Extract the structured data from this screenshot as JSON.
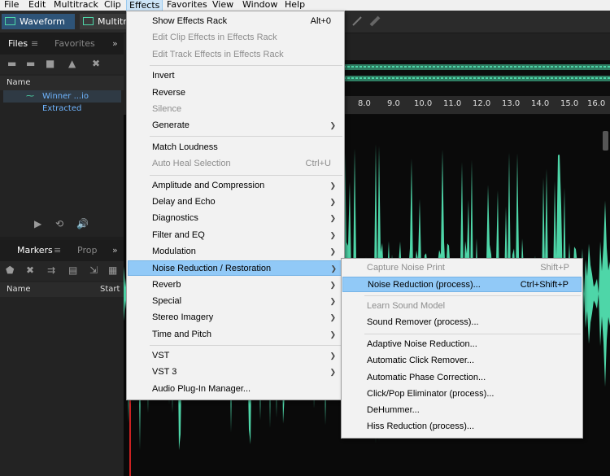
{
  "menubar": [
    "File",
    "Edit",
    "Multitrack",
    "Clip",
    "Effects",
    "Favorites",
    "View",
    "Window",
    "Help"
  ],
  "toolbar": {
    "waveform": "Waveform",
    "multitrack": "Multitr"
  },
  "files_panel": {
    "tab_files": "Files",
    "tab_favorites": "Favorites",
    "col_name": "Name",
    "file": "Winner ...io Extracted"
  },
  "markers_panel": {
    "tab_markers": "Markers",
    "tab_prop": "Prop",
    "col_name": "Name",
    "col_start": "Start"
  },
  "ruler": [
    "8.0",
    "9.0",
    "10.0",
    "11.0",
    "12.0",
    "13.0",
    "14.0",
    "15.0",
    "16.0"
  ],
  "effects_menu": {
    "items": [
      {
        "label": "Show Effects Rack",
        "shortcut": "Alt+0"
      },
      {
        "label": "Edit Clip Effects in Effects Rack",
        "disabled": true
      },
      {
        "label": "Edit Track Effects in Effects Rack",
        "disabled": true
      },
      {
        "label": "Invert"
      },
      {
        "label": "Reverse"
      },
      {
        "label": "Silence",
        "disabled": true
      },
      {
        "label": "Generate",
        "submenu": true
      },
      {
        "label": "Match Loudness"
      },
      {
        "label": "Auto Heal Selection",
        "shortcut": "Ctrl+U",
        "disabled": true
      },
      {
        "label": "Amplitude and Compression",
        "submenu": true
      },
      {
        "label": "Delay and Echo",
        "submenu": true
      },
      {
        "label": "Diagnostics",
        "submenu": true
      },
      {
        "label": "Filter and EQ",
        "submenu": true
      },
      {
        "label": "Modulation",
        "submenu": true
      },
      {
        "label": "Noise Reduction / Restoration",
        "submenu": true
      },
      {
        "label": "Reverb",
        "submenu": true
      },
      {
        "label": "Special",
        "submenu": true
      },
      {
        "label": "Stereo Imagery",
        "submenu": true
      },
      {
        "label": "Time and Pitch",
        "submenu": true
      },
      {
        "label": "VST",
        "submenu": true
      },
      {
        "label": "VST 3",
        "submenu": true
      },
      {
        "label": "Audio Plug-In Manager..."
      }
    ]
  },
  "noise_menu": {
    "items": [
      {
        "label": "Capture Noise Print",
        "shortcut": "Shift+P",
        "disabled": true
      },
      {
        "label": "Noise Reduction (process)...",
        "shortcut": "Ctrl+Shift+P"
      },
      {
        "label": "Learn Sound Model",
        "disabled": true
      },
      {
        "label": "Sound Remover (process)..."
      },
      {
        "label": "Adaptive Noise Reduction..."
      },
      {
        "label": "Automatic Click Remover..."
      },
      {
        "label": "Automatic Phase Correction..."
      },
      {
        "label": "Click/Pop Eliminator (process)..."
      },
      {
        "label": "DeHummer..."
      },
      {
        "label": "Hiss Reduction (process)..."
      }
    ]
  },
  "colors": {
    "wave": "#4ed6a8",
    "highlight": "#91c9f7",
    "playhead": "#c22222"
  }
}
